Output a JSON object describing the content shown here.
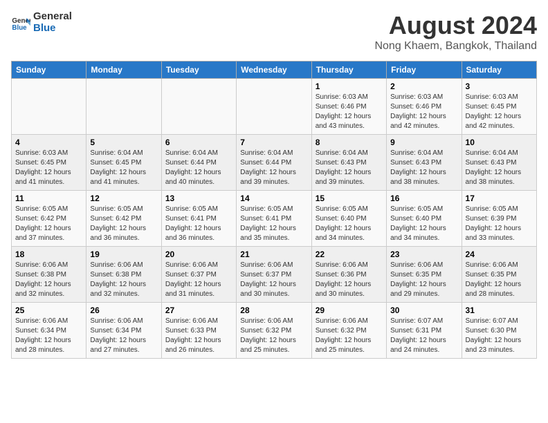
{
  "header": {
    "logo_line1": "General",
    "logo_line2": "Blue",
    "title": "August 2024",
    "subtitle": "Nong Khaem, Bangkok, Thailand"
  },
  "weekdays": [
    "Sunday",
    "Monday",
    "Tuesday",
    "Wednesday",
    "Thursday",
    "Friday",
    "Saturday"
  ],
  "weeks": [
    [
      {
        "day": "",
        "info": ""
      },
      {
        "day": "",
        "info": ""
      },
      {
        "day": "",
        "info": ""
      },
      {
        "day": "",
        "info": ""
      },
      {
        "day": "1",
        "info": "Sunrise: 6:03 AM\nSunset: 6:46 PM\nDaylight: 12 hours\nand 43 minutes."
      },
      {
        "day": "2",
        "info": "Sunrise: 6:03 AM\nSunset: 6:46 PM\nDaylight: 12 hours\nand 42 minutes."
      },
      {
        "day": "3",
        "info": "Sunrise: 6:03 AM\nSunset: 6:45 PM\nDaylight: 12 hours\nand 42 minutes."
      }
    ],
    [
      {
        "day": "4",
        "info": "Sunrise: 6:03 AM\nSunset: 6:45 PM\nDaylight: 12 hours\nand 41 minutes."
      },
      {
        "day": "5",
        "info": "Sunrise: 6:04 AM\nSunset: 6:45 PM\nDaylight: 12 hours\nand 41 minutes."
      },
      {
        "day": "6",
        "info": "Sunrise: 6:04 AM\nSunset: 6:44 PM\nDaylight: 12 hours\nand 40 minutes."
      },
      {
        "day": "7",
        "info": "Sunrise: 6:04 AM\nSunset: 6:44 PM\nDaylight: 12 hours\nand 39 minutes."
      },
      {
        "day": "8",
        "info": "Sunrise: 6:04 AM\nSunset: 6:43 PM\nDaylight: 12 hours\nand 39 minutes."
      },
      {
        "day": "9",
        "info": "Sunrise: 6:04 AM\nSunset: 6:43 PM\nDaylight: 12 hours\nand 38 minutes."
      },
      {
        "day": "10",
        "info": "Sunrise: 6:04 AM\nSunset: 6:43 PM\nDaylight: 12 hours\nand 38 minutes."
      }
    ],
    [
      {
        "day": "11",
        "info": "Sunrise: 6:05 AM\nSunset: 6:42 PM\nDaylight: 12 hours\nand 37 minutes."
      },
      {
        "day": "12",
        "info": "Sunrise: 6:05 AM\nSunset: 6:42 PM\nDaylight: 12 hours\nand 36 minutes."
      },
      {
        "day": "13",
        "info": "Sunrise: 6:05 AM\nSunset: 6:41 PM\nDaylight: 12 hours\nand 36 minutes."
      },
      {
        "day": "14",
        "info": "Sunrise: 6:05 AM\nSunset: 6:41 PM\nDaylight: 12 hours\nand 35 minutes."
      },
      {
        "day": "15",
        "info": "Sunrise: 6:05 AM\nSunset: 6:40 PM\nDaylight: 12 hours\nand 34 minutes."
      },
      {
        "day": "16",
        "info": "Sunrise: 6:05 AM\nSunset: 6:40 PM\nDaylight: 12 hours\nand 34 minutes."
      },
      {
        "day": "17",
        "info": "Sunrise: 6:05 AM\nSunset: 6:39 PM\nDaylight: 12 hours\nand 33 minutes."
      }
    ],
    [
      {
        "day": "18",
        "info": "Sunrise: 6:06 AM\nSunset: 6:38 PM\nDaylight: 12 hours\nand 32 minutes."
      },
      {
        "day": "19",
        "info": "Sunrise: 6:06 AM\nSunset: 6:38 PM\nDaylight: 12 hours\nand 32 minutes."
      },
      {
        "day": "20",
        "info": "Sunrise: 6:06 AM\nSunset: 6:37 PM\nDaylight: 12 hours\nand 31 minutes."
      },
      {
        "day": "21",
        "info": "Sunrise: 6:06 AM\nSunset: 6:37 PM\nDaylight: 12 hours\nand 30 minutes."
      },
      {
        "day": "22",
        "info": "Sunrise: 6:06 AM\nSunset: 6:36 PM\nDaylight: 12 hours\nand 30 minutes."
      },
      {
        "day": "23",
        "info": "Sunrise: 6:06 AM\nSunset: 6:35 PM\nDaylight: 12 hours\nand 29 minutes."
      },
      {
        "day": "24",
        "info": "Sunrise: 6:06 AM\nSunset: 6:35 PM\nDaylight: 12 hours\nand 28 minutes."
      }
    ],
    [
      {
        "day": "25",
        "info": "Sunrise: 6:06 AM\nSunset: 6:34 PM\nDaylight: 12 hours\nand 28 minutes."
      },
      {
        "day": "26",
        "info": "Sunrise: 6:06 AM\nSunset: 6:34 PM\nDaylight: 12 hours\nand 27 minutes."
      },
      {
        "day": "27",
        "info": "Sunrise: 6:06 AM\nSunset: 6:33 PM\nDaylight: 12 hours\nand 26 minutes."
      },
      {
        "day": "28",
        "info": "Sunrise: 6:06 AM\nSunset: 6:32 PM\nDaylight: 12 hours\nand 25 minutes."
      },
      {
        "day": "29",
        "info": "Sunrise: 6:06 AM\nSunset: 6:32 PM\nDaylight: 12 hours\nand 25 minutes."
      },
      {
        "day": "30",
        "info": "Sunrise: 6:07 AM\nSunset: 6:31 PM\nDaylight: 12 hours\nand 24 minutes."
      },
      {
        "day": "31",
        "info": "Sunrise: 6:07 AM\nSunset: 6:30 PM\nDaylight: 12 hours\nand 23 minutes."
      }
    ]
  ]
}
